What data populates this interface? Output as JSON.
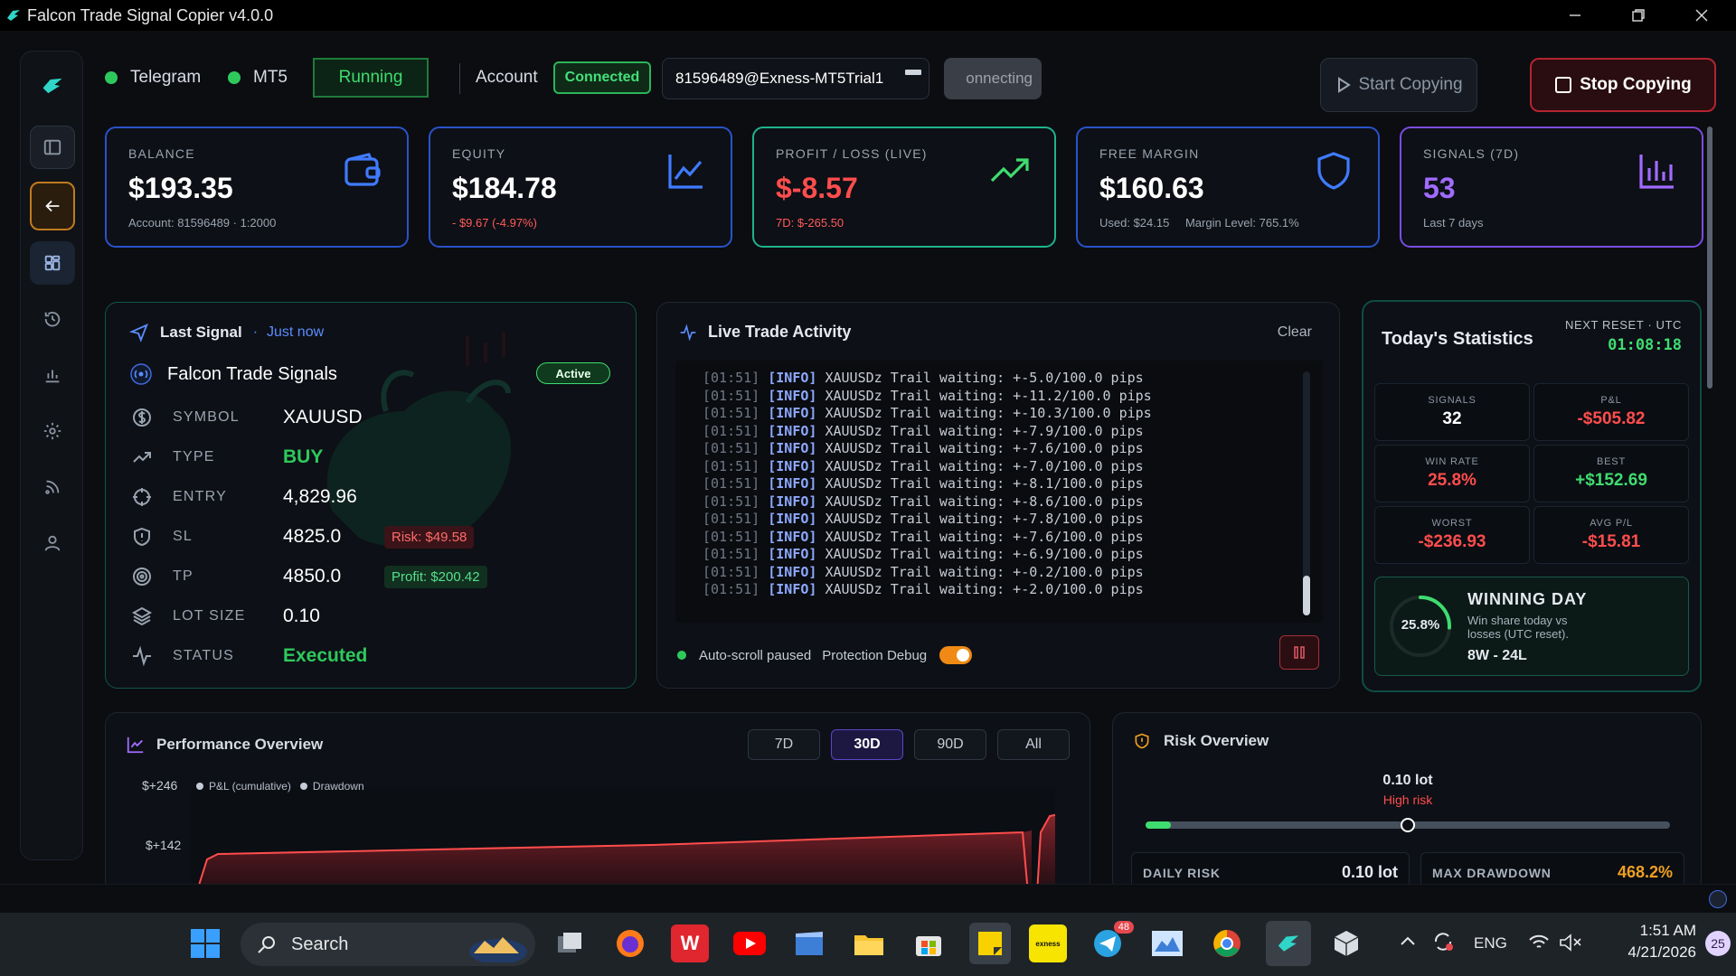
{
  "window": {
    "title": "Falcon Trade Signal Copier v4.0.0"
  },
  "header": {
    "telegram_label": "Telegram",
    "mt5_label": "MT5",
    "running_label": "Running",
    "account_label": "Account",
    "connected_label": "Connected",
    "account_value": "81596489@Exness-MT5Trial1",
    "connecting_label": "onnecting",
    "start_label": "Start Copying",
    "stop_label": "Stop Copying"
  },
  "cards": {
    "balance": {
      "label": "BALANCE",
      "value": "$193.35",
      "sub": "Account: 81596489 · 1:2000"
    },
    "equity": {
      "label": "EQUITY",
      "value": "$184.78",
      "sub": "- $9.67 (-4.97%)"
    },
    "pnl": {
      "label": "PROFIT / LOSS (LIVE)",
      "value": "$-8.57",
      "sub": "7D: $-265.50"
    },
    "free_margin": {
      "label": "FREE MARGIN",
      "value": "$160.63",
      "sub_used": "Used: $24.15",
      "sub_level": "Margin Level: 765.1%"
    },
    "signals": {
      "label": "SIGNALS (7D)",
      "value": "53",
      "sub": "Last 7 days"
    }
  },
  "last_signal": {
    "title": "Last Signal",
    "when": "Just now",
    "channel": "Falcon Trade Signals",
    "status_badge": "Active",
    "rows": [
      {
        "key": "SYMBOL",
        "value": "XAUUSD"
      },
      {
        "key": "TYPE",
        "value": "BUY"
      },
      {
        "key": "ENTRY",
        "value": "4,829.96"
      },
      {
        "key": "SL",
        "value": "4825.0",
        "tag": "Risk: $49.58"
      },
      {
        "key": "TP",
        "value": "4850.0",
        "tag": "Profit: $200.42"
      },
      {
        "key": "LOT SIZE",
        "value": "0.10"
      },
      {
        "key": "STATUS",
        "value": "Executed"
      }
    ]
  },
  "live_activity": {
    "title": "Live Trade Activity",
    "clear_label": "Clear",
    "lines": [
      {
        "ts": "[01:51]",
        "level": "[INFO]",
        "msg": "XAUUSDz Trail waiting: +-5.0/100.0 pips"
      },
      {
        "ts": "[01:51]",
        "level": "[INFO]",
        "msg": "XAUUSDz Trail waiting: +-11.2/100.0 pips"
      },
      {
        "ts": "[01:51]",
        "level": "[INFO]",
        "msg": "XAUUSDz Trail waiting: +-10.3/100.0 pips"
      },
      {
        "ts": "[01:51]",
        "level": "[INFO]",
        "msg": "XAUUSDz Trail waiting: +-7.9/100.0 pips"
      },
      {
        "ts": "[01:51]",
        "level": "[INFO]",
        "msg": "XAUUSDz Trail waiting: +-7.6/100.0 pips"
      },
      {
        "ts": "[01:51]",
        "level": "[INFO]",
        "msg": "XAUUSDz Trail waiting: +-7.0/100.0 pips"
      },
      {
        "ts": "[01:51]",
        "level": "[INFO]",
        "msg": "XAUUSDz Trail waiting: +-8.1/100.0 pips"
      },
      {
        "ts": "[01:51]",
        "level": "[INFO]",
        "msg": "XAUUSDz Trail waiting: +-8.6/100.0 pips"
      },
      {
        "ts": "[01:51]",
        "level": "[INFO]",
        "msg": "XAUUSDz Trail waiting: +-7.8/100.0 pips"
      },
      {
        "ts": "[01:51]",
        "level": "[INFO]",
        "msg": "XAUUSDz Trail waiting: +-7.6/100.0 pips"
      },
      {
        "ts": "[01:51]",
        "level": "[INFO]",
        "msg": "XAUUSDz Trail waiting: +-6.9/100.0 pips"
      },
      {
        "ts": "[01:51]",
        "level": "[INFO]",
        "msg": "XAUUSDz Trail waiting: +-0.2/100.0 pips"
      },
      {
        "ts": "[01:51]",
        "level": "[INFO]",
        "msg": "XAUUSDz Trail waiting: +-2.0/100.0 pips"
      }
    ],
    "autoscroll_label": "Auto-scroll paused",
    "protection_label": "Protection Debug",
    "protection_on": true
  },
  "today": {
    "title": "Today's Statistics",
    "reset_label": "NEXT RESET · UTC",
    "reset_value": "01:08:18",
    "stats": {
      "signals": {
        "label": "SIGNALS",
        "value": "32"
      },
      "pnl": {
        "label": "P&L",
        "value": "-$505.82"
      },
      "win_rate": {
        "label": "WIN RATE",
        "value": "25.8%"
      },
      "best": {
        "label": "BEST",
        "value": "+$152.69"
      },
      "worst": {
        "label": "WORST",
        "value": "-$236.93"
      },
      "avg": {
        "label": "AVG P/L",
        "value": "-$15.81"
      }
    },
    "winning_day": {
      "title": "WINNING DAY",
      "desc": "Win share today vs losses (UTC reset).",
      "record": "8W - 24L",
      "pct_label": "25.8%",
      "pct": 0.258
    }
  },
  "performance": {
    "title": "Performance Overview",
    "ranges": [
      "7D",
      "30D",
      "90D",
      "All"
    ],
    "active_range": "30D",
    "legend_pnl": "P&L (cumulative)",
    "legend_dd": "Drawdown",
    "y_ticks": [
      "$+246",
      "$+142"
    ]
  },
  "risk": {
    "title": "Risk Overview",
    "lot": "0.10 lot",
    "level": "High risk",
    "slider_pos": 0.5,
    "daily_risk_label": "DAILY RISK",
    "daily_risk_value": "0.10 lot",
    "max_dd_label": "MAX DRAWDOWN",
    "max_dd_value": "468.2%"
  },
  "taskbar": {
    "search_placeholder": "Search",
    "lang": "ENG",
    "time": "1:51 AM",
    "date": "4/21/2026",
    "telegram_badge": "48",
    "notif_count": "25"
  },
  "colors": {
    "green": "#3fdc6f",
    "red": "#ff4d4d",
    "blue_border": "#2a52c9",
    "teal_border": "#1fb38c",
    "purple": "#a06bff",
    "orange": "#f0a020"
  }
}
